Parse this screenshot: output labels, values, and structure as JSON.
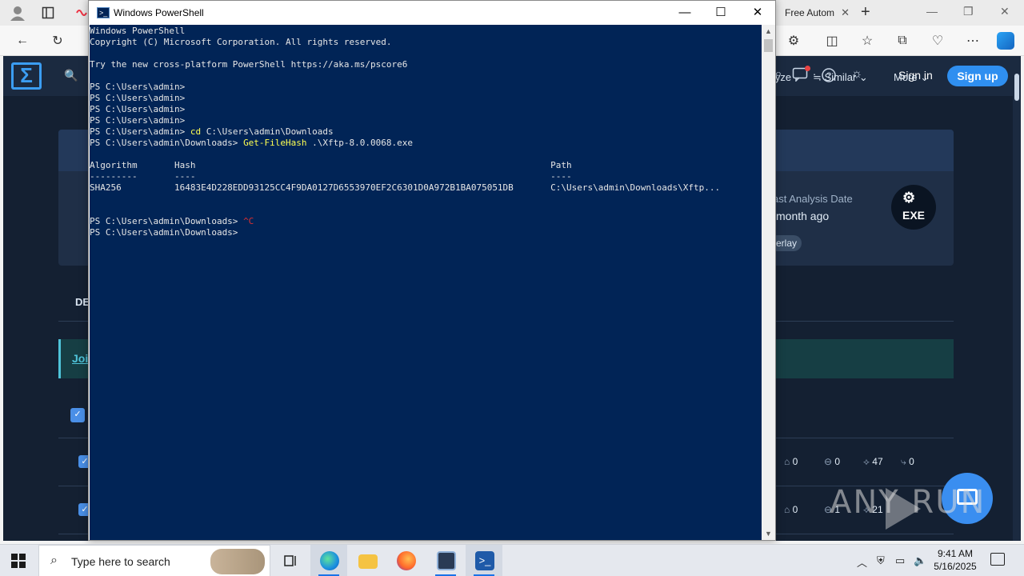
{
  "browser": {
    "tab_free_title": "Free Autom",
    "new_tab_symbol": "+",
    "ctl_minimize": "—",
    "ctl_restore": "❐",
    "ctl_close": "✕"
  },
  "site": {
    "signin": "Sign in",
    "signup": "Sign up",
    "analyze_partial": "lyze",
    "similar": "Similar",
    "more": "More",
    "last_analysis_label": "ast Analysis Date",
    "last_analysis_value": "month ago",
    "overlay_partial": "erlay",
    "exe_label": "EXE",
    "det_partial": "DE",
    "banner_partial": "Joi",
    "row1_stats": [
      "0",
      "0",
      "47",
      "0"
    ],
    "row2_stats": [
      "0",
      "1",
      "21"
    ],
    "watermark": "ANY RUN"
  },
  "powershell": {
    "title": "Windows PowerShell",
    "ctl_minimize": "—",
    "ctl_maximize": "☐",
    "ctl_close": "✕",
    "lines": [
      {
        "text": "Windows PowerShell"
      },
      {
        "text": "Copyright (C) Microsoft Corporation. All rights reserved."
      },
      {
        "text": ""
      },
      {
        "text": "Try the new cross-platform PowerShell https://aka.ms/pscore6"
      },
      {
        "text": ""
      },
      {
        "text": "PS C:\\Users\\admin>"
      },
      {
        "text": "PS C:\\Users\\admin>"
      },
      {
        "text": "PS C:\\Users\\admin>"
      },
      {
        "text": "PS C:\\Users\\admin>"
      },
      {
        "prompt": "PS C:\\Users\\admin> ",
        "cmd": "cd",
        "args": " C:\\Users\\admin\\Downloads"
      },
      {
        "prompt": "PS C:\\Users\\admin\\Downloads> ",
        "cmd": "Get-FileHash",
        "args": " .\\Xftp-8.0.0068.exe"
      },
      {
        "text": ""
      },
      {
        "text": "Algorithm       Hash                                                                   Path"
      },
      {
        "text": "---------       ----                                                                   ----"
      },
      {
        "text": "SHA256          16483E4D228EDD93125CC4F9DA0127D6553970EF2C6301D0A972B1BA075051DB       C:\\Users\\admin\\Downloads\\Xftp..."
      },
      {
        "text": ""
      },
      {
        "text": ""
      },
      {
        "prompt": "PS C:\\Users\\admin\\Downloads> ",
        "red": "^C"
      },
      {
        "text": "PS C:\\Users\\admin\\Downloads>"
      }
    ]
  },
  "taskbar": {
    "search_placeholder": "Type here to search",
    "time": "9:41 AM",
    "date": "5/16/2025"
  }
}
